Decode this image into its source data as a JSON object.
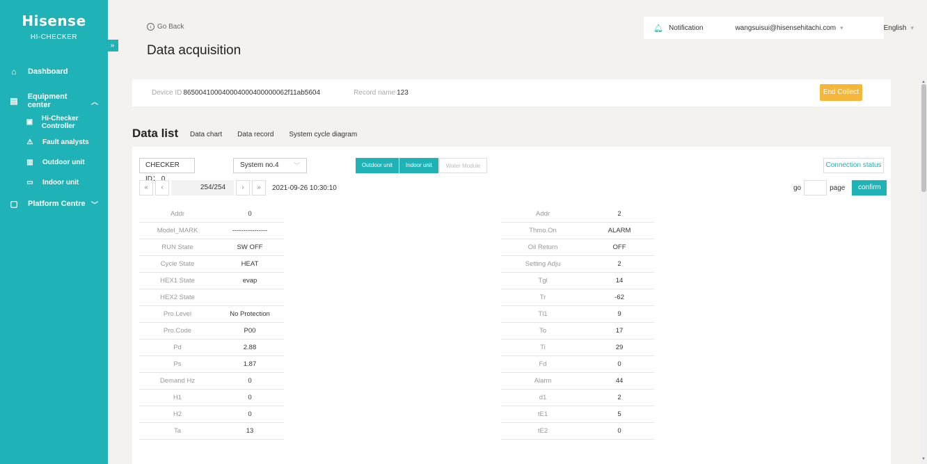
{
  "sidebar": {
    "logo": "Hisense",
    "subtitle": "HI-CHECKER",
    "dashboard": "Dashboard",
    "equipment_center": "Equipment center",
    "sub_items": [
      "Hi-Checker Controller",
      "Fault analysts",
      "Outdoor unit",
      "Indoor unit"
    ],
    "platform_centre": "Platform Centre",
    "accent_color": "#1fb2b7"
  },
  "header": {
    "go_back": "Go Back",
    "title": "Data acquisition",
    "notification": "Notification",
    "email": "wangsuisui@hisensehitachi.com",
    "language": "English"
  },
  "info": {
    "device_id_label": "Device ID",
    "device_id": "865004100040004000400000062f11ab5604",
    "record_name_label": "Record name",
    "record_name": "123",
    "end_collect": "End Collect"
  },
  "data_list": {
    "title": "Data list",
    "tabs": [
      "Data chart",
      "Data record",
      "System cycle diagram"
    ]
  },
  "controls": {
    "checker_id": "CHECKER ID： 0",
    "system": "System no.4",
    "unit_tabs": [
      "Outdoor unit",
      "Indoor unit",
      "Water Module"
    ],
    "connection_status": "Connection status",
    "page": "254/254",
    "timestamp": "2021-09-26 10:30:10",
    "go": "go",
    "page_label": "page",
    "confirm": "confirm"
  },
  "left_table": [
    {
      "k": "Addr",
      "v": "0"
    },
    {
      "k": "Model_MARK",
      "v": "----------------"
    },
    {
      "k": "RUN State",
      "v": "SW OFF"
    },
    {
      "k": "Cycle State",
      "v": "HEAT"
    },
    {
      "k": "HEX1 State",
      "v": "evap"
    },
    {
      "k": "HEX2 State",
      "v": ""
    },
    {
      "k": "Pro.Level",
      "v": "No Protection"
    },
    {
      "k": "Pro.Code",
      "v": "P00"
    },
    {
      "k": "Pd",
      "v": "2.88"
    },
    {
      "k": "Ps",
      "v": "1.87"
    },
    {
      "k": "Demand Hz",
      "v": "0"
    },
    {
      "k": "H1",
      "v": "0"
    },
    {
      "k": "H2",
      "v": "0"
    },
    {
      "k": "Ta",
      "v": "13"
    }
  ],
  "right_table": [
    {
      "k": "Addr",
      "v": "2"
    },
    {
      "k": "Thmo.On",
      "v": "ALARM"
    },
    {
      "k": "Oil Return",
      "v": "OFF"
    },
    {
      "k": "Setting Adju",
      "v": "2"
    },
    {
      "k": "Tgl",
      "v": "14"
    },
    {
      "k": "Tr",
      "v": "-62"
    },
    {
      "k": "Tl1",
      "v": "9"
    },
    {
      "k": "To",
      "v": "17"
    },
    {
      "k": "Ti",
      "v": "29"
    },
    {
      "k": "Fd",
      "v": "0"
    },
    {
      "k": "Alarm",
      "v": "44"
    },
    {
      "k": "d1",
      "v": "2"
    },
    {
      "k": "tE1",
      "v": "5"
    },
    {
      "k": "tE2",
      "v": "0"
    }
  ]
}
